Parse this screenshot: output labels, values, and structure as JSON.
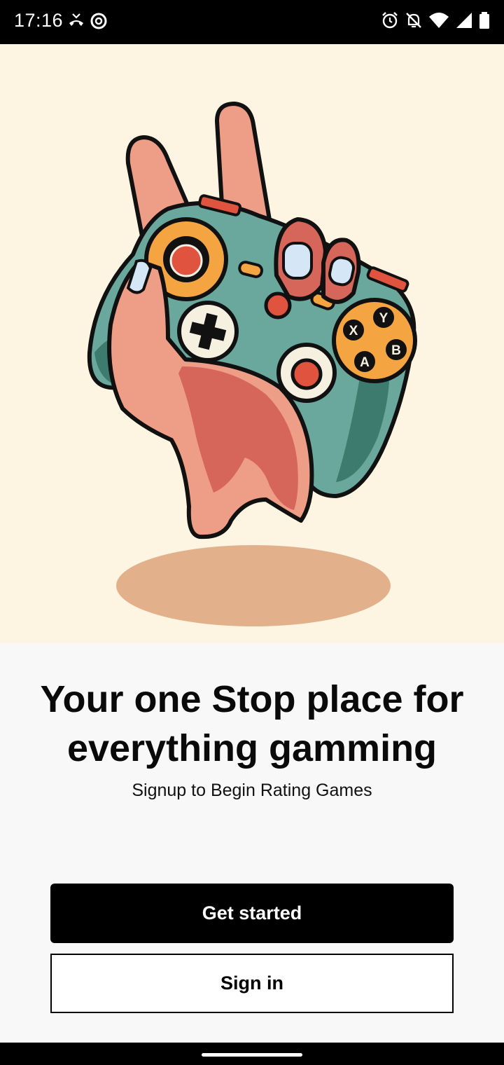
{
  "status_bar": {
    "time": "17:16",
    "left_icons": [
      "missed-call-icon",
      "data-saver-icon"
    ],
    "right_icons": [
      "alarm-icon",
      "notifications-off-icon",
      "wifi-icon",
      "signal-icon",
      "battery-icon"
    ]
  },
  "hero": {
    "illustration": "hand-holding-game-controller",
    "controller_buttons": [
      "Y",
      "X",
      "B",
      "A"
    ],
    "colors": {
      "background": "#fdf5e2",
      "controller": "#6aa89d",
      "skin": "#ee9e86",
      "shadow": "#e3b08c"
    }
  },
  "main": {
    "headline": "Your one Stop place for everything gamming",
    "subtitle": "Signup to Begin Rating Games"
  },
  "actions": {
    "get_started_label": "Get started",
    "sign_in_label": "Sign in"
  }
}
